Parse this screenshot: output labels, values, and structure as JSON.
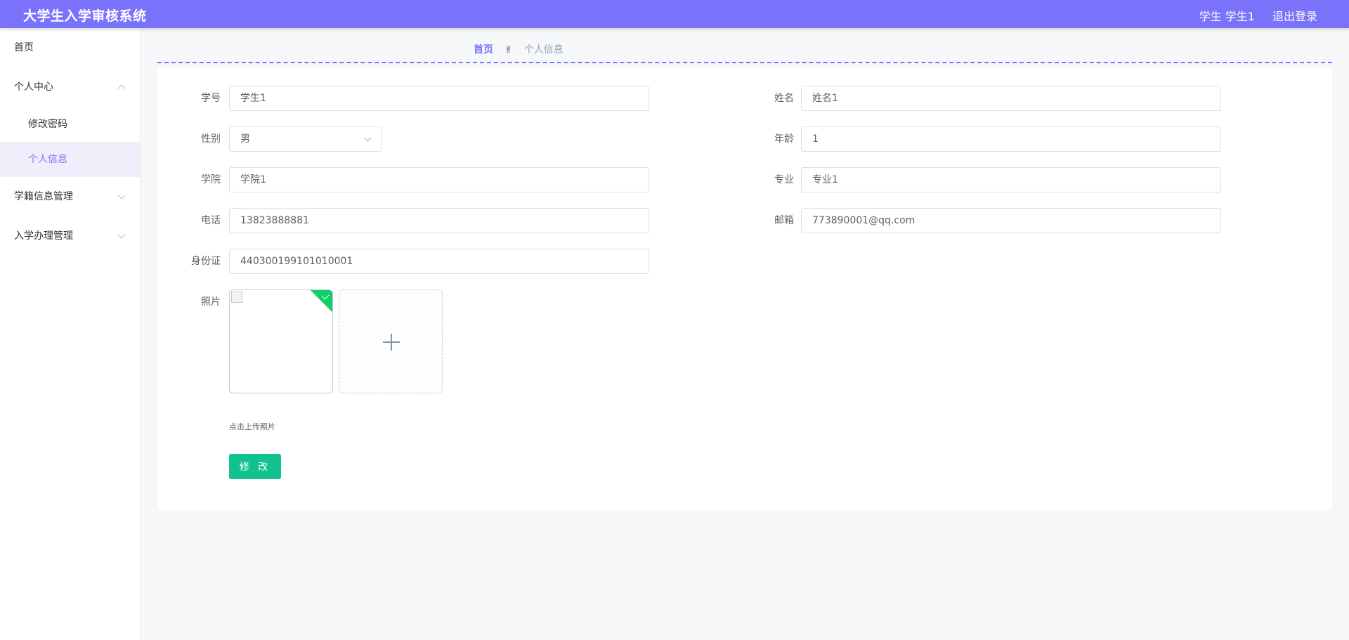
{
  "header": {
    "title": "大学生入学审核系统",
    "user": "学生 学生1",
    "logout": "退出登录"
  },
  "sidebar": {
    "items": [
      {
        "label": "首页"
      },
      {
        "label": "个人中心"
      },
      {
        "label": "修改密码"
      },
      {
        "label": "个人信息"
      },
      {
        "label": "学籍信息管理"
      },
      {
        "label": "入学办理管理"
      }
    ]
  },
  "breadcrumb": {
    "home": "首页",
    "separator": "✌",
    "current": "个人信息"
  },
  "form": {
    "student_id": {
      "label": "学号",
      "value": "学生1"
    },
    "name": {
      "label": "姓名",
      "value": "姓名1"
    },
    "gender": {
      "label": "性别",
      "value": "男"
    },
    "age": {
      "label": "年龄",
      "value": "1"
    },
    "college": {
      "label": "学院",
      "value": "学院1"
    },
    "major": {
      "label": "专业",
      "value": "专业1"
    },
    "phone": {
      "label": "电话",
      "value": "13823888881"
    },
    "email": {
      "label": "邮箱",
      "value": "773890001@qq.com"
    },
    "id_card": {
      "label": "身份证",
      "value": "440300199101010001"
    },
    "photo": {
      "label": "照片",
      "tip": "点击上传照片"
    },
    "submit": "修 改"
  },
  "colors": {
    "accent": "#7a72fb",
    "button": "#11c28f",
    "success": "#13ce66"
  }
}
